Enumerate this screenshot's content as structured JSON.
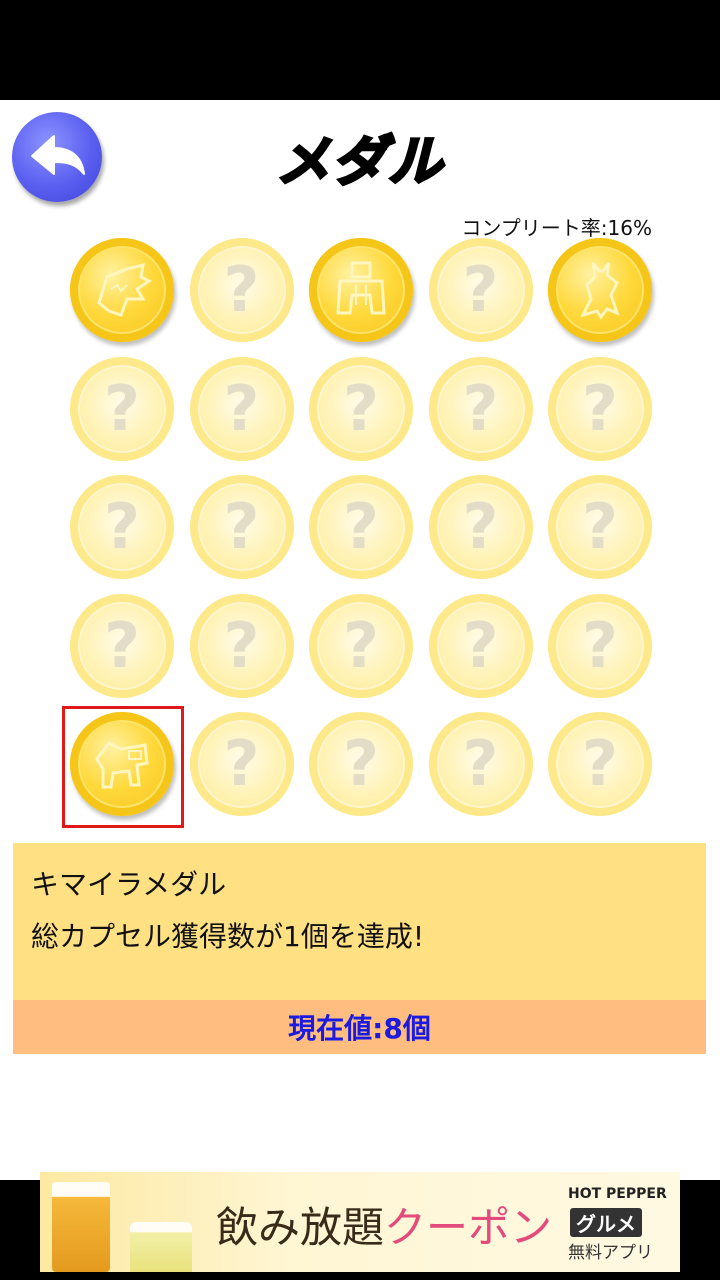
{
  "header": {
    "title": "メダル",
    "completion_rate": "コンプリート率:16%"
  },
  "medals": [
    {
      "unlocked": true,
      "icon": "medal-creature-icon-1"
    },
    {
      "unlocked": false
    },
    {
      "unlocked": true,
      "icon": "medal-creature-icon-2"
    },
    {
      "unlocked": false
    },
    {
      "unlocked": true,
      "icon": "medal-creature-icon-3"
    },
    {
      "unlocked": false
    },
    {
      "unlocked": false
    },
    {
      "unlocked": false
    },
    {
      "unlocked": false
    },
    {
      "unlocked": false
    },
    {
      "unlocked": false
    },
    {
      "unlocked": false
    },
    {
      "unlocked": false
    },
    {
      "unlocked": false
    },
    {
      "unlocked": false
    },
    {
      "unlocked": false
    },
    {
      "unlocked": false
    },
    {
      "unlocked": false
    },
    {
      "unlocked": false
    },
    {
      "unlocked": false
    },
    {
      "unlocked": true,
      "icon": "medal-chimera-icon",
      "selected": true
    },
    {
      "unlocked": false
    },
    {
      "unlocked": false
    },
    {
      "unlocked": false
    },
    {
      "unlocked": false
    }
  ],
  "locked_glyph": "?",
  "detail": {
    "name": "キマイラメダル",
    "description": "総カプセル獲得数が1個を達成!",
    "current_value": "現在値:8個"
  },
  "ad": {
    "main_a": "飲み放題",
    "main_b": "クーポン",
    "brand": "HOT PEPPER",
    "logo": "グルメ",
    "sub": "無料アプリ"
  },
  "colors": {
    "accent_blue": "#5a5ff0",
    "selection": "#e01818",
    "info_bg": "#ffe083",
    "progress_bg": "#ffbd80",
    "progress_text": "#1a1ae0"
  }
}
